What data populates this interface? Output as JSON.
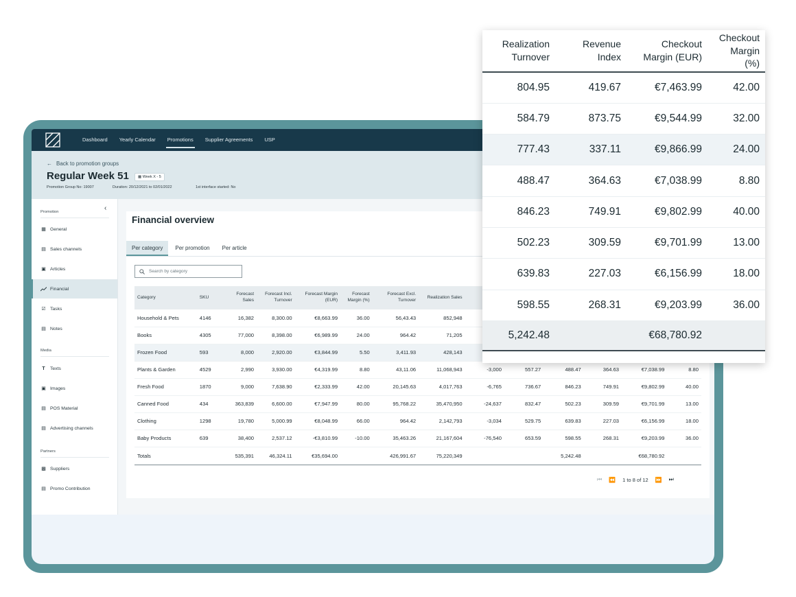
{
  "nav": {
    "items": [
      "Dashboard",
      "Yearly Calendar",
      "Promotions",
      "Supplier Agreements",
      "USP"
    ],
    "active": "Promotions"
  },
  "header": {
    "back_link": "Back to promotion groups",
    "title": "Regular Week 51",
    "week_badge": "Week X - 5",
    "group_no": "Promotion Group No: 19007",
    "duration": "Duration: 20/12/2021 to 02/01/2022",
    "interface": "1st interface started: No"
  },
  "sidebar": {
    "promotion_label": "Promotion",
    "promotion_items": [
      {
        "label": "General",
        "icon": "grid-icon"
      },
      {
        "label": "Sales channels",
        "icon": "storefront-icon"
      },
      {
        "label": "Articles",
        "icon": "box-icon"
      },
      {
        "label": "Financial",
        "icon": "trend-chart-icon"
      },
      {
        "label": "Tasks",
        "icon": "checkbox-icon"
      },
      {
        "label": "Notes",
        "icon": "document-icon"
      }
    ],
    "media_label": "Media",
    "media_items": [
      {
        "label": "Texts",
        "icon": "text-icon"
      },
      {
        "label": "Images",
        "icon": "image-icon"
      },
      {
        "label": "POS Material",
        "icon": "pos-icon"
      },
      {
        "label": "Advertising channels",
        "icon": "advertising-icon"
      }
    ],
    "partners_label": "Partners",
    "partner_items": [
      {
        "label": "Suppliers",
        "icon": "truck-icon"
      },
      {
        "label": "Promo Contribution",
        "icon": "document-euro-icon"
      }
    ]
  },
  "main": {
    "title": "Financial overview",
    "tabs": [
      "Per category",
      "Per promotion",
      "Per article"
    ],
    "search_placeholder": "Search by category",
    "columns": [
      "Category",
      "SKU",
      "Forecast Sales",
      "Forecast Incl. Turnover",
      "Forecast Margin (EUR)",
      "Forecast Margin (%)",
      "Forecast Excl. Turnover",
      "Realization Sales",
      "",
      "",
      "",
      "",
      "",
      ""
    ],
    "rows": [
      [
        "Household & Pets",
        "4146",
        "16,382",
        "8,300.00",
        "€8,663.99",
        "36.00",
        "56,43.43",
        "852,948",
        "",
        "",
        "",
        "",
        "",
        ""
      ],
      [
        "Books",
        "4305",
        "77,000",
        "8,398.00",
        "€6,989.99",
        "24.00",
        "964.42",
        "71,205",
        "",
        "",
        "",
        "",
        "",
        ""
      ],
      [
        "Frozen Food",
        "593",
        "8,000",
        "2,920.00",
        "€3,844.99",
        "5.50",
        "3,411.93",
        "428,143",
        "",
        "",
        "",
        "",
        "",
        ""
      ],
      [
        "Plants & Garden",
        "4529",
        "2,990",
        "3,930.00",
        "€4,319.99",
        "8.80",
        "43,11.06",
        "11,068,943",
        "-3,000",
        "557.27",
        "488.47",
        "364.63",
        "€7,038.99",
        "8.80"
      ],
      [
        "Fresh Food",
        "1870",
        "9,000",
        "7,638.90",
        "€2,333.99",
        "42.00",
        "20,145.63",
        "4,017,763",
        "-6,765",
        "736.67",
        "846.23",
        "749.91",
        "€9,802.99",
        "40.00"
      ],
      [
        "Canned Food",
        "434",
        "363,839",
        "6,600.00",
        "€7,947.99",
        "80.00",
        "95,768.22",
        "35,470,950",
        "-24,637",
        "832.47",
        "502.23",
        "309.59",
        "€9,701.99",
        "13.00"
      ],
      [
        "Clothing",
        "1298",
        "19,780",
        "5,000.99",
        "€8,048.99",
        "66.00",
        "964.42",
        "2,142,793",
        "-3,034",
        "529.75",
        "639.83",
        "227.03",
        "€6,156.99",
        "18.00"
      ],
      [
        "Baby Products",
        "639",
        "38,400",
        "2,537.12",
        "-€3,810.99",
        "-10.00",
        "35,463.26",
        "21,167,604",
        "-76,540",
        "653.59",
        "598.55",
        "268.31",
        "€9,203.99",
        "36.00"
      ]
    ],
    "totals": [
      "Totals",
      "",
      "535,391",
      "46,324.11",
      "€35,694.00",
      "",
      "426,991.67",
      "75,220,349",
      "",
      "",
      "5,242.48",
      "",
      "€68,780.92",
      ""
    ],
    "pager_text": "1 to 8 of 12"
  },
  "zoom": {
    "columns": [
      "Realization Turnover",
      "Revenue Index",
      "Checkout Margin (EUR)",
      "Checkout Margin (%)"
    ],
    "rows": [
      [
        "804.95",
        "419.67",
        "€7,463.99",
        "42.00"
      ],
      [
        "584.79",
        "873.75",
        "€9,544.99",
        "32.00"
      ],
      [
        "777.43",
        "337.11",
        "€9,866.99",
        "24.00"
      ],
      [
        "488.47",
        "364.63",
        "€7,038.99",
        "8.80"
      ],
      [
        "846.23",
        "749.91",
        "€9,802.99",
        "40.00"
      ],
      [
        "502.23",
        "309.59",
        "€9,701.99",
        "13.00"
      ],
      [
        "639.83",
        "227.03",
        "€6,156.99",
        "18.00"
      ],
      [
        "598.55",
        "268.31",
        "€9,203.99",
        "36.00"
      ]
    ],
    "totals": [
      "5,242.48",
      "",
      "€68,780.92",
      ""
    ]
  },
  "colors": {
    "frame": "#5b959b",
    "nav": "#18394a",
    "header": "#dde8ec",
    "negative": "#d22a2a"
  }
}
